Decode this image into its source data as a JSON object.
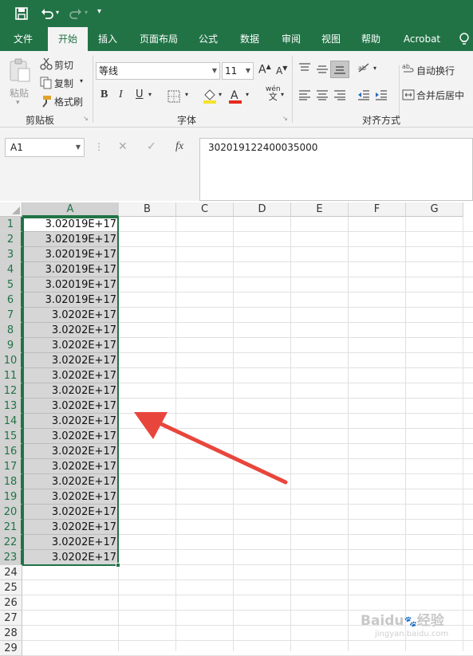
{
  "tabs": [
    "文件",
    "开始",
    "插入",
    "页面布局",
    "公式",
    "数据",
    "审阅",
    "视图",
    "帮助",
    "Acrobat"
  ],
  "clipboard": {
    "paste": "粘贴",
    "cut": "剪切",
    "copy": "复制",
    "format_painter": "格式刷",
    "group_label": "剪贴板"
  },
  "font": {
    "name": "等线",
    "size": "11",
    "bold": "B",
    "italic": "I",
    "underline": "U",
    "group_label": "字体",
    "phonetic": "wén",
    "phonetic_sub": "文"
  },
  "alignment": {
    "wrap_text": "自动换行",
    "merge_center": "合并后居中",
    "group_label": "对齐方式"
  },
  "formula_bar": {
    "name_box": "A1",
    "fx": "fx",
    "value": "302019122400035000"
  },
  "columns": [
    "A",
    "B",
    "C",
    "D",
    "E",
    "F",
    "G"
  ],
  "rows": [
    "1",
    "2",
    "3",
    "4",
    "5",
    "6",
    "7",
    "8",
    "9",
    "10",
    "11",
    "12",
    "13",
    "14",
    "15",
    "16",
    "17",
    "18",
    "19",
    "20",
    "21",
    "22",
    "23",
    "24",
    "25",
    "26",
    "27",
    "28",
    "29"
  ],
  "cells_A": [
    "3.02019E+17",
    "3.02019E+17",
    "3.02019E+17",
    "3.02019E+17",
    "3.02019E+17",
    "3.02019E+17",
    "3.0202E+17",
    "3.0202E+17",
    "3.0202E+17",
    "3.0202E+17",
    "3.0202E+17",
    "3.0202E+17",
    "3.0202E+17",
    "3.0202E+17",
    "3.0202E+17",
    "3.0202E+17",
    "3.0202E+17",
    "3.0202E+17",
    "3.0202E+17",
    "3.0202E+17",
    "3.0202E+17",
    "3.0202E+17",
    "3.0202E+17"
  ],
  "watermark": {
    "brand": "Baidu",
    "suffix": "经验",
    "url": "jingyan.baidu.com"
  },
  "colors": {
    "accent": "#217346",
    "arrow": "#e8463c"
  }
}
